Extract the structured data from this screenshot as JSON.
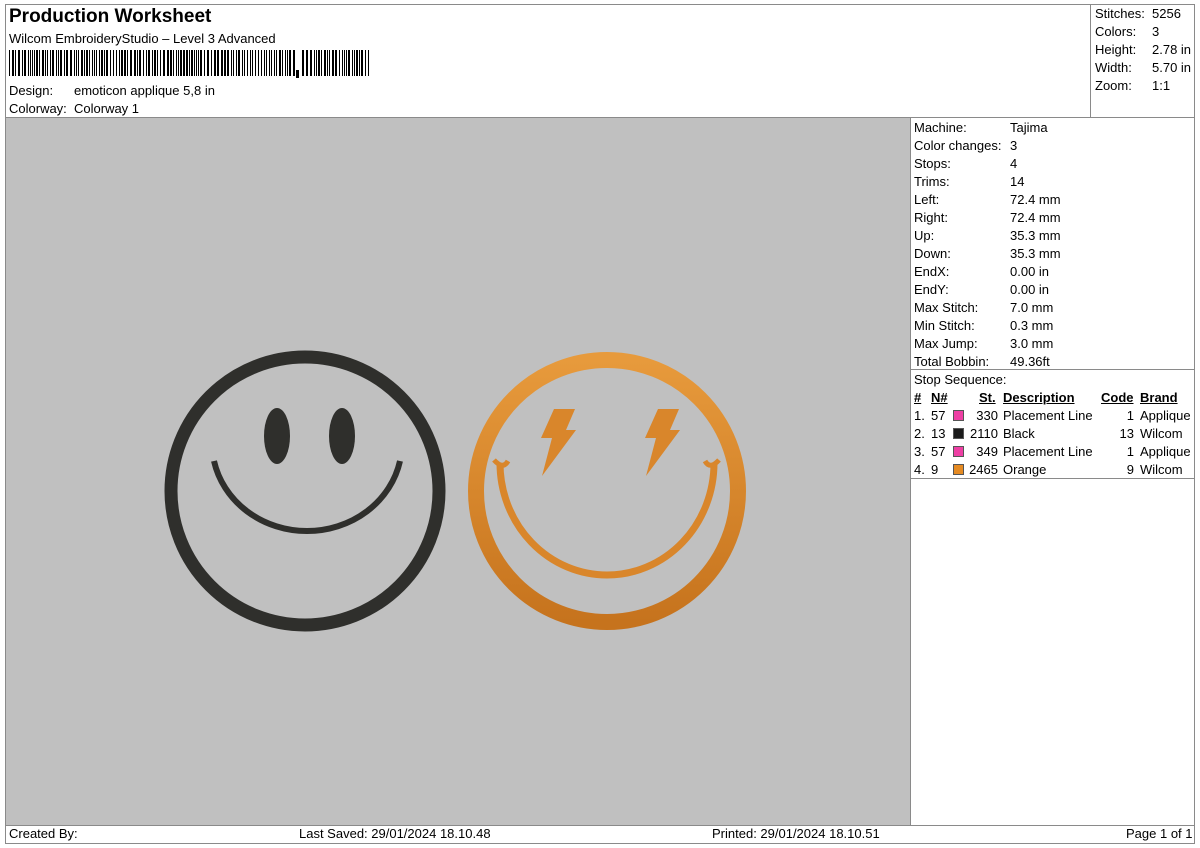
{
  "header": {
    "title": "Production Worksheet",
    "subtitle": "Wilcom EmbroideryStudio – Level 3 Advanced",
    "design_label": "Design:",
    "design_value": "emoticon applique 5,8 in",
    "colorway_label": "Colorway:",
    "colorway_value": "Colorway 1"
  },
  "top_right": [
    {
      "label": "Stitches:",
      "value": "5256"
    },
    {
      "label": "Colors:",
      "value": "3"
    },
    {
      "label": "Height:",
      "value": "2.78 in"
    },
    {
      "label": "Width:",
      "value": "5.70 in"
    },
    {
      "label": "Zoom:",
      "value": "1:1"
    }
  ],
  "machine_info": [
    {
      "label": "Machine:",
      "value": "Tajima"
    },
    {
      "label": "Color changes:",
      "value": "3"
    },
    {
      "label": "Stops:",
      "value": "4"
    },
    {
      "label": "Trims:",
      "value": "14"
    },
    {
      "label": "Left:",
      "value": "72.4 mm"
    },
    {
      "label": "Right:",
      "value": "72.4 mm"
    },
    {
      "label": "Up:",
      "value": "35.3 mm"
    },
    {
      "label": "Down:",
      "value": "35.3 mm"
    },
    {
      "label": "EndX:",
      "value": "0.00 in"
    },
    {
      "label": "EndY:",
      "value": "0.00 in"
    },
    {
      "label": "Max Stitch:",
      "value": "7.0 mm"
    },
    {
      "label": "Min Stitch:",
      "value": "0.3 mm"
    },
    {
      "label": "Max Jump:",
      "value": "3.0 mm"
    },
    {
      "label": "Total Bobbin:",
      "value": "49.36ft"
    }
  ],
  "stop_sequence": {
    "title": "Stop Sequence:",
    "columns": {
      "num": "#",
      "n": "N#",
      "st": "St.",
      "description": "Description",
      "code": "Code",
      "brand": "Brand"
    },
    "rows": [
      {
        "num": "1.",
        "n": "57",
        "color": "#ee3fa4",
        "st": "330",
        "description": "Placement Line",
        "code": "1",
        "brand": "Applique"
      },
      {
        "num": "2.",
        "n": "13",
        "color": "#1b1b1b",
        "st": "2110",
        "description": "Black",
        "code": "13",
        "brand": "Wilcom"
      },
      {
        "num": "3.",
        "n": "57",
        "color": "#ee3fa4",
        "st": "349",
        "description": "Placement Line",
        "code": "1",
        "brand": "Applique"
      },
      {
        "num": "4.",
        "n": "9",
        "color": "#e58a22",
        "st": "2465",
        "description": "Orange",
        "code": "9",
        "brand": "Wilcom"
      }
    ]
  },
  "footer": {
    "created_by": "Created By:",
    "last_saved": "Last Saved: 29/01/2024 18.10.48",
    "printed": "Printed: 29/01/2024 18.10.51",
    "page": "Page 1 of 1"
  },
  "colors": {
    "canvas": "#c0c0c0",
    "black_thread": "#2f2f2c",
    "orange_thread": "#d9862b"
  }
}
